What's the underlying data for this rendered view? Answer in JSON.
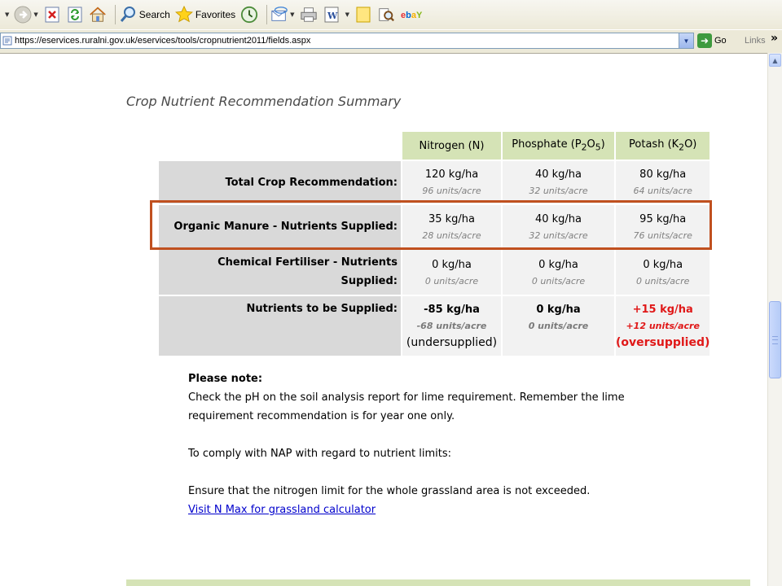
{
  "toolbar": {
    "search_label": "Search",
    "favorites_label": "Favorites"
  },
  "address": {
    "url": "https://eservices.ruralni.gov.uk/eservices/tools/cropnutrient2011/fields.aspx",
    "go_label": "Go",
    "links_label": "Links"
  },
  "page": {
    "heading": "Crop Nutrient Recommendation Summary"
  },
  "table": {
    "columns": {
      "nitrogen": "Nitrogen (N)",
      "phosphate_prefix": "Phosphate (P",
      "phosphate_sub1": "2",
      "phosphate_mid": "O",
      "phosphate_sub2": "5",
      "phosphate_suffix": ")",
      "potash_prefix": "Potash (K",
      "potash_sub1": "2",
      "potash_suffix": "O)"
    },
    "rows": [
      {
        "label": "Total Crop Recommendation:",
        "n_val": "120 kg/ha",
        "n_sub": "96 units/acre",
        "p_val": "40 kg/ha",
        "p_sub": "32 units/acre",
        "k_val": "80 kg/ha",
        "k_sub": "64 units/acre"
      },
      {
        "label": "Organic Manure - Nutrients Supplied:",
        "n_val": "35 kg/ha",
        "n_sub": "28 units/acre",
        "p_val": "40 kg/ha",
        "p_sub": "32 units/acre",
        "k_val": "95 kg/ha",
        "k_sub": "76 units/acre"
      },
      {
        "label_line1": "Chemical Fertiliser - Nutrients",
        "label_line2": "Supplied:",
        "n_val": "0 kg/ha",
        "n_sub": "0 units/acre",
        "p_val": "0 kg/ha",
        "p_sub": "0 units/acre",
        "k_val": "0 kg/ha",
        "k_sub": "0 units/acre"
      },
      {
        "label": "Nutrients to be Supplied:",
        "n_val": "-85 kg/ha",
        "n_sub": "-68 units/acre",
        "n_note": "(undersupplied)",
        "p_val": "0 kg/ha",
        "p_sub": "0 units/acre",
        "k_val": "+15 kg/ha",
        "k_sub": "+12 units/acre",
        "k_note": "(oversupplied)"
      }
    ]
  },
  "notes": {
    "title": "Please note:",
    "line1": "Check the pH on the soil analysis report for lime requirement. Remember the lime",
    "line2": "requirement recommendation is for year one only.",
    "line3": "To comply with NAP with regard to nutrient limits:",
    "line4": "Ensure that the nitrogen limit for the whole grassland area is not exceeded.",
    "link": "Visit N Max for grassland calculator"
  },
  "colors": {
    "header_green": "#d5e3b6",
    "label_grey": "#d9d9d9",
    "cell_grey": "#f2f2f2",
    "highlight_border": "#c0501f",
    "oversupplied_red": "#e01818",
    "link_blue": "#0000cc"
  },
  "icons": [
    "back-icon",
    "forward-icon",
    "stop-icon",
    "refresh-icon",
    "home-icon",
    "search-icon",
    "favorites-star-icon",
    "history-icon",
    "mail-icon",
    "print-icon",
    "word-icon",
    "notes-icon",
    "research-icon",
    "ebay-icon"
  ]
}
